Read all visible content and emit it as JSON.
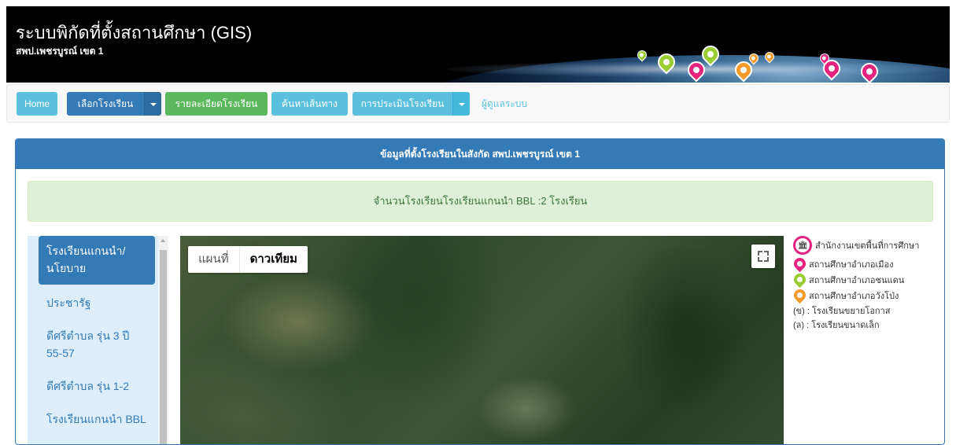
{
  "header": {
    "title": "ระบบพิกัดที่ตั้งสถานศึกษา (GIS)",
    "subtitle": "สพป.เพชรบูรณ์ เขต 1",
    "pin_colors": [
      "#9acd32",
      "#e5227e",
      "#f39a2a"
    ]
  },
  "navbar": {
    "home": "Home",
    "choose_school": "เลือกโรงเรียน",
    "school_detail": "รายละเอียดโรงเรียน",
    "find_route": "ค้นหาเส้นทาง",
    "school_assessment": "การประเมินโรงเรียน",
    "admin": "ผู้ดูแลระบบ"
  },
  "panel": {
    "heading": "ข้อมูลที่ตั้งโรงเรียนในสังกัด สพป.เพชรบูรณ์ เขต 1",
    "alert": "จำนวนโรงเรียนโรงเรียนแกนนำ BBL :2 โรงเรียน"
  },
  "sidebar": {
    "items": [
      {
        "label": "โรงเรียนแกนนำ/นโยบาย",
        "active": true
      },
      {
        "label": "ประชารัฐ",
        "active": false
      },
      {
        "label": "ดีศรีตำบล รุ่น 3 ปี 55-57",
        "active": false
      },
      {
        "label": "ดีศรีตำบล รุ่น 1-2",
        "active": false
      },
      {
        "label": "โรงเรียนแกนนำ BBL",
        "active": false
      }
    ]
  },
  "map": {
    "type_map": "แผนที่",
    "type_satellite": "ดาวเทียม",
    "selected_type": "ดาวเทียม"
  },
  "legend": {
    "office": "สำนักงานเขตพื้นที่การศึกษา",
    "district_muang": "สถานศึกษาอำเภอเมือง",
    "district_chondaen": "สถานศึกษาอำเภอชนแดน",
    "district_wangpong": "สถานศึกษาอำเภอวังโป่ง",
    "note_expansion": "(ข) : โรงเรียนขยายโอกาส",
    "note_small": "(ล) : โรงเรียนขนาดเล็ก",
    "colors": {
      "office": "#e5227e",
      "muang": "#e5227e",
      "chondaen": "#9acd32",
      "wangpong": "#f39a2a"
    }
  }
}
